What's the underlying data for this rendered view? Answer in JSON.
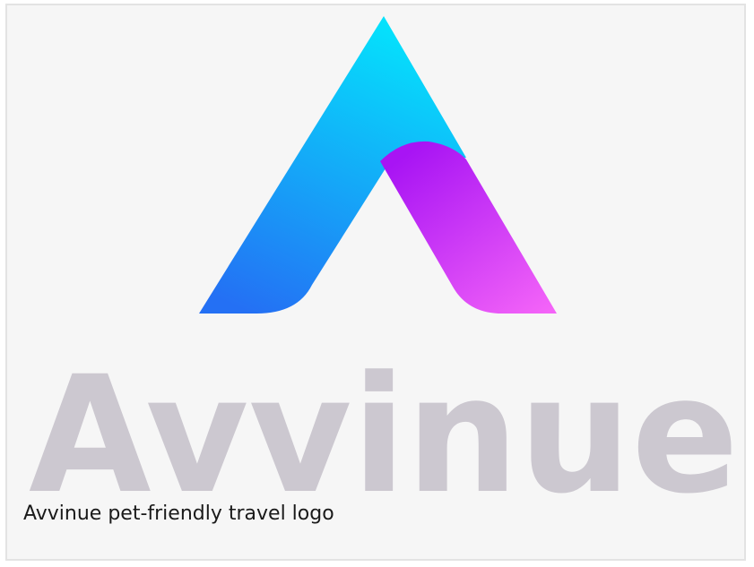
{
  "logo": {
    "wordmark": "Avvinue",
    "colors": {
      "cyan": "#04e4fc",
      "blue": "#2470f4",
      "purple": "#a814f4",
      "pink": "#f464f8",
      "wordmark_gray": "#ccc8d0"
    }
  },
  "caption": "Avvinue pet-friendly travel logo"
}
